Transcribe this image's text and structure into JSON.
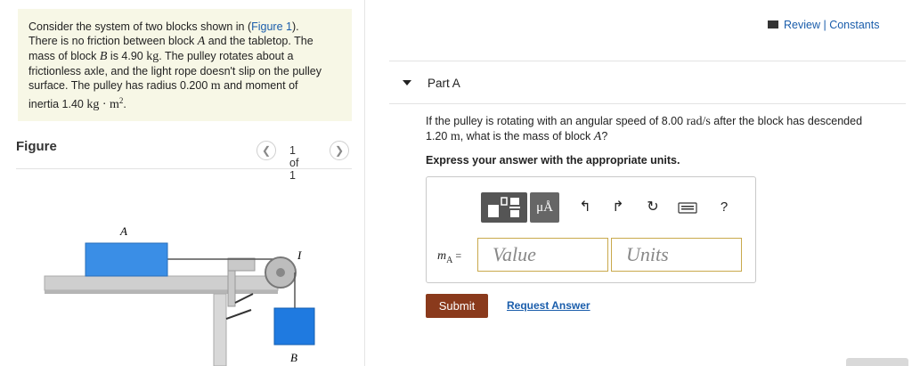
{
  "problem": {
    "line1_pre": "Consider the system of two blocks shown in (",
    "figure_link": "Figure 1",
    "line1_post": ").",
    "line2_pre": "There is no friction between block ",
    "block_a": "A",
    "line2_post": " and the tabletop. The",
    "line3_pre": "mass of block ",
    "block_b": "B",
    "line3_mid": " is 4.90 ",
    "mass_unit": "kg",
    "line3_post": ". The pulley rotates about a",
    "line4": "frictionless axle, and the light rope doesn't slip on the pulley",
    "line5_pre": "surface. The pulley has radius 0.200 ",
    "radius_unit": "m",
    "line5_post": " and moment of",
    "line6_pre": "inertia 1.40 ",
    "inertia_unit": "kg · m",
    "inertia_exp": "2",
    "line6_post": "."
  },
  "figure": {
    "title": "Figure",
    "count": "1 of 1",
    "prev_icon": "chevron-left-icon",
    "next_icon": "chevron-right-icon",
    "label_a": "A",
    "label_b": "B",
    "label_i": "I",
    "block_color": "#3a8ee6",
    "block_b_color": "#1f7ae0"
  },
  "header": {
    "review": "Review",
    "separator": " | ",
    "constants": "Constants"
  },
  "part": {
    "label": "Part A"
  },
  "question": {
    "q1_pre": "If the pulley is rotating with an angular speed of 8.00 ",
    "speed_unit": "rad/s",
    "q1_post": " after the block has descended",
    "q2_pre": "1.20 ",
    "dist_unit": "m",
    "q2_mid": ", what is the mass of block ",
    "q2_block": "A",
    "q2_post": "?"
  },
  "instruction": "Express your answer with the appropriate units.",
  "toolbar": {
    "units_label": "μÅ",
    "help_label": "?",
    "undo_icon": "undo-icon",
    "redo_icon": "redo-icon",
    "reset_icon": "reset-icon",
    "keyboard_icon": "keyboard-icon"
  },
  "answer": {
    "var_label": "m",
    "var_sub": "A",
    "equals": " =",
    "value_placeholder": "Value",
    "units_placeholder": "Units"
  },
  "actions": {
    "submit": "Submit",
    "request": "Request Answer"
  },
  "colors": {
    "accent_link": "#1a5dab",
    "submit_bg": "#8a3a1c",
    "problem_bg": "#f7f7e6"
  }
}
